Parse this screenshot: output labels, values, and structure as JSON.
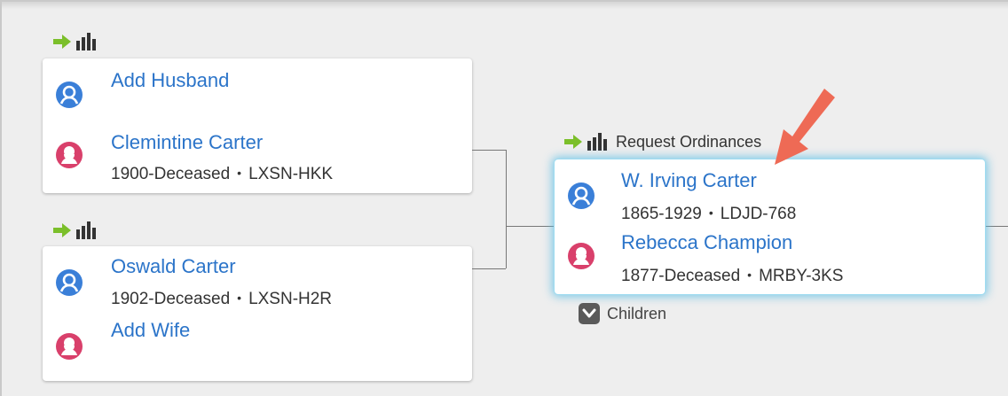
{
  "colors": {
    "link_blue": "#2b74c9",
    "male_avatar": "#3a7fd8",
    "female_avatar": "#d9406b",
    "temple_green": "#7bbf2a",
    "annotation_arrow": "#ee6a55",
    "selected_glow": "#5abee6"
  },
  "icons": {
    "ordinance_arrow": "green-arrow-icon",
    "temple": "temple-icon",
    "male": "male-avatar-icon",
    "female": "female-avatar-icon",
    "children_toggle": "chevron-down-icon",
    "annotation": "red-pointer-arrow"
  },
  "parent_couple_1": {
    "husband": {
      "name": "Add Husband"
    },
    "wife": {
      "name": "Clemintine Carter",
      "dates": "1900-Deceased",
      "id": "LXSN-HKK"
    }
  },
  "parent_couple_2": {
    "husband": {
      "name": "Oswald Carter",
      "dates": "1902-Deceased",
      "id": "LXSN-H2R"
    },
    "wife": {
      "name": "Add Wife"
    }
  },
  "focus_couple": {
    "request_label": "Request Ordinances",
    "husband": {
      "name": "W. Irving Carter",
      "dates": "1865-1929",
      "id": "LDJD-768"
    },
    "wife": {
      "name": "Rebecca Champion",
      "dates": "1877-Deceased",
      "id": "MRBY-3KS"
    },
    "children_label": "Children"
  },
  "separator": "•"
}
